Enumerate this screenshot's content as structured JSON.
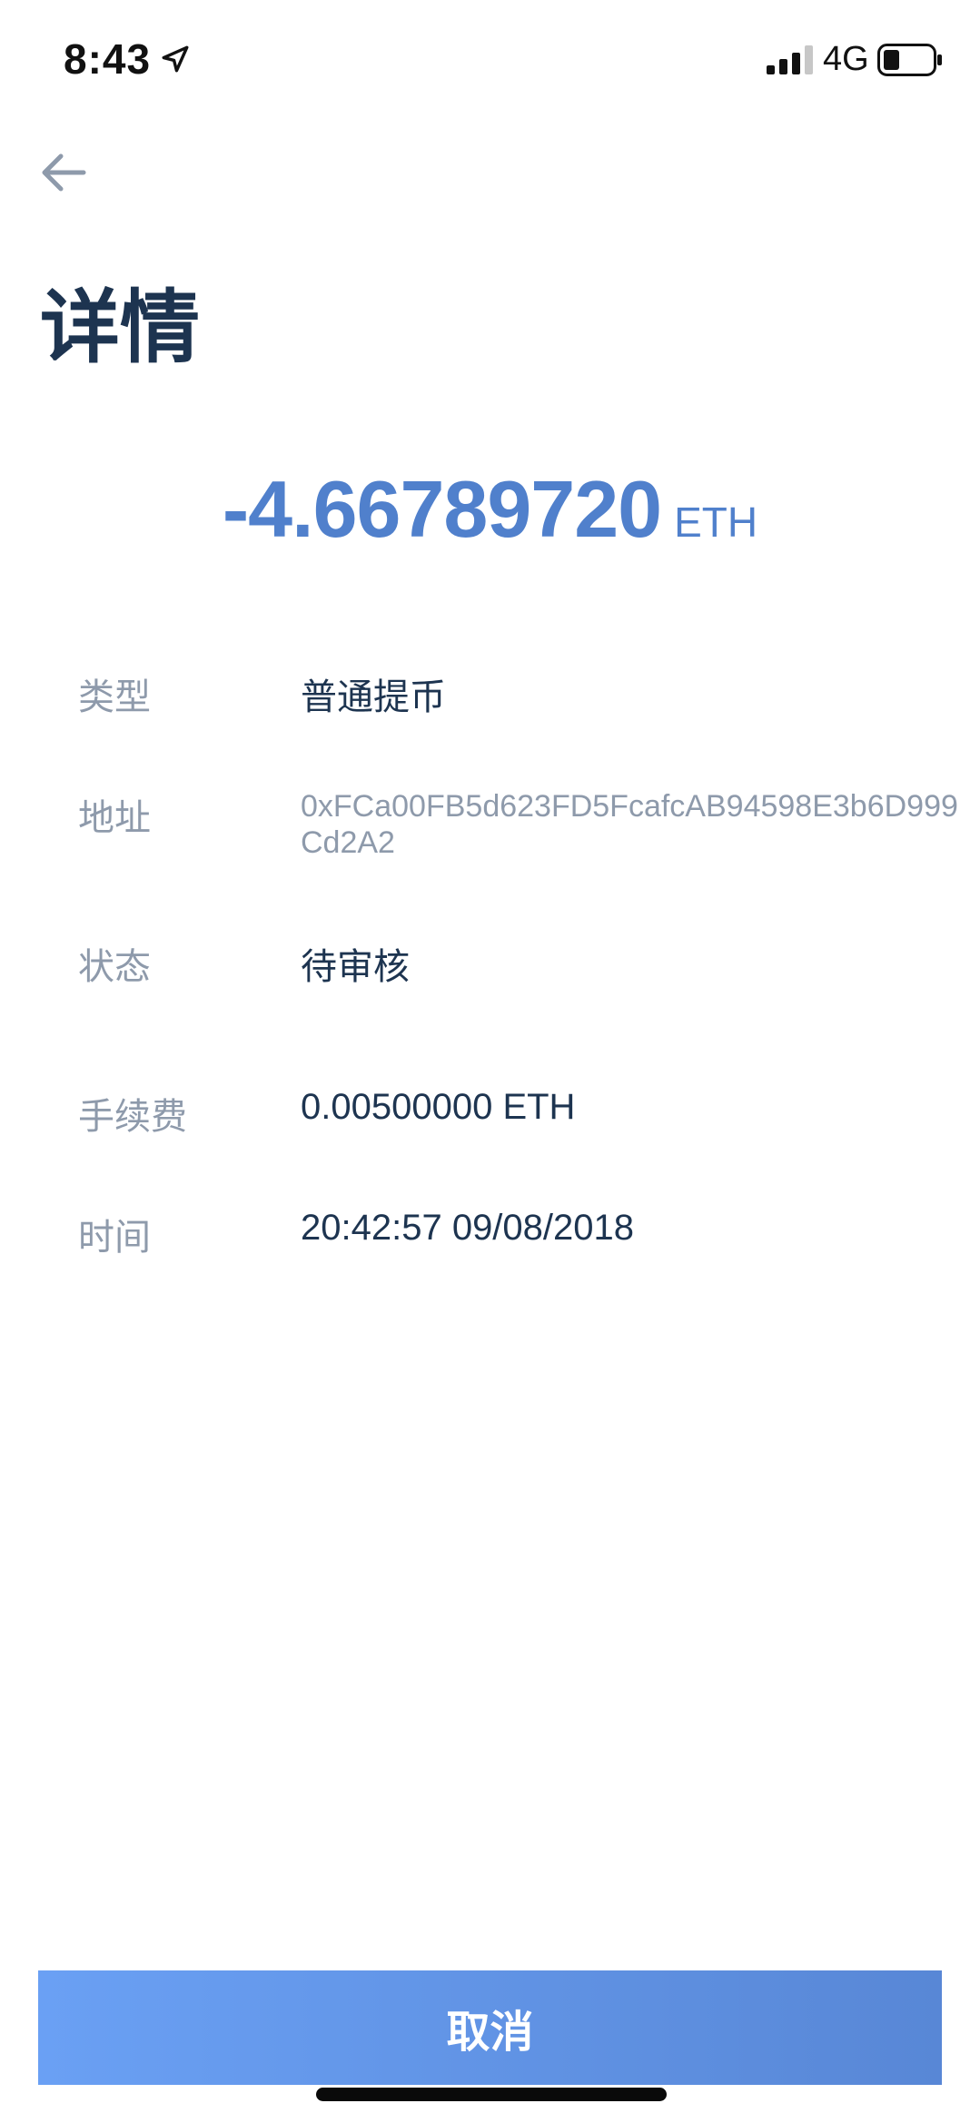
{
  "status_bar": {
    "time": "8:43",
    "network": "4G",
    "location_icon": "location-arrow-icon",
    "signal_icon": "cellular-signal-icon",
    "battery_icon": "battery-low-icon"
  },
  "header": {
    "back_icon": "arrow-left-icon",
    "title": "详情"
  },
  "amount": {
    "value": "-4.66789720",
    "unit": "ETH"
  },
  "details": [
    {
      "label": "类型",
      "value": "普通提币"
    },
    {
      "label": "地址",
      "value": "0xFCa00FB5d623FD5FcafcAB94598E3b6D999Cd2A2"
    },
    {
      "label": "状态",
      "value": "待审核"
    },
    {
      "label": "手续费",
      "value": "0.00500000 ETH"
    },
    {
      "label": "时间",
      "value": "20:42:57 09/08/2018"
    }
  ],
  "actions": {
    "cancel_label": "取消"
  },
  "colors": {
    "accent": "#5080cc",
    "title": "#1d3450",
    "muted": "#8e9aab",
    "button_start": "#6aa0f4",
    "button_end": "#5887d6"
  }
}
